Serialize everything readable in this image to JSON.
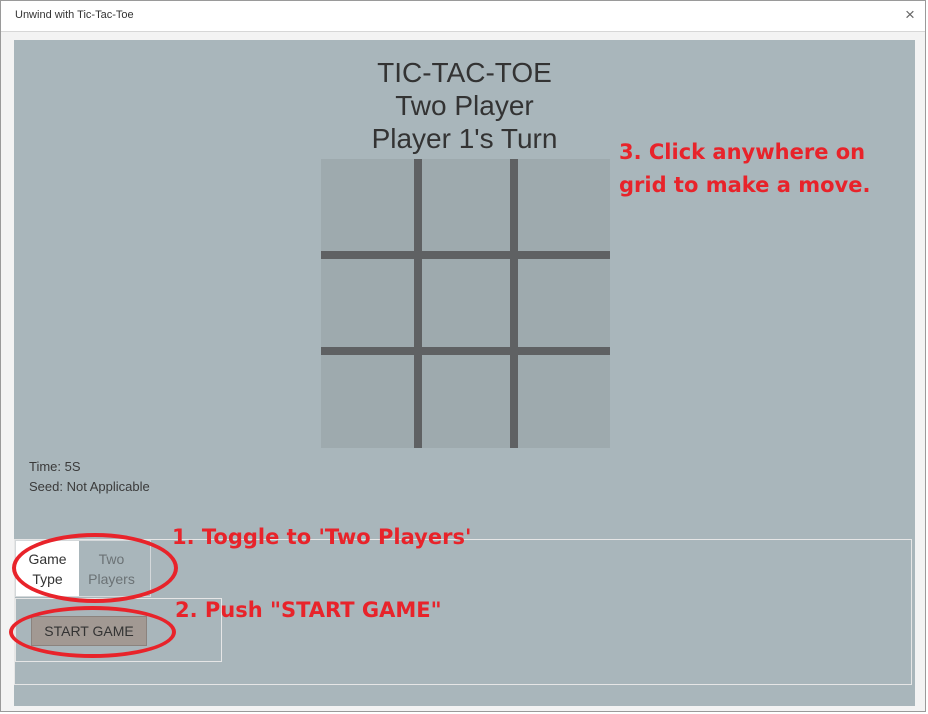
{
  "window": {
    "title": "Unwind with Tic-Tac-Toe",
    "close_glyph": "×"
  },
  "game": {
    "title": "TIC-TAC-TOE",
    "mode": "Two Player",
    "turn": "Player 1's Turn",
    "time": "Time: 5S",
    "seed": "Seed: Not Applicable"
  },
  "board": {
    "cells": [
      "",
      "",
      "",
      "",
      "",
      "",
      "",
      "",
      ""
    ]
  },
  "controls": {
    "toggle_active_line1": "Game",
    "toggle_active_line2": "Type",
    "toggle_inactive_line1": "Two",
    "toggle_inactive_line2": "Players",
    "start_label": "START GAME"
  },
  "annotations": {
    "step1": "1. Toggle to 'Two Players'",
    "step2": "2. Push \"START GAME\"",
    "step3_line1": "3. Click anywhere on",
    "step3_line2": "grid to make a move."
  },
  "colors": {
    "annotation": "#e8232a",
    "background": "#a9b6bb",
    "grid_lines": "#5f6163",
    "start_button": "#a29993"
  },
  "icons": {
    "close": "close-icon"
  }
}
